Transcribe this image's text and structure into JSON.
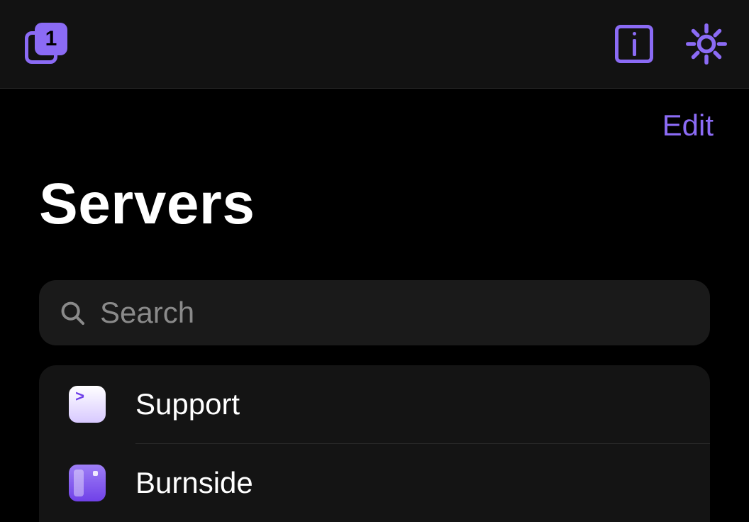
{
  "toolbar": {
    "tab_count": "1"
  },
  "header": {
    "edit_label": "Edit",
    "title": "Servers"
  },
  "search": {
    "placeholder": "Search",
    "value": ""
  },
  "servers": [
    {
      "name": "Support",
      "icon": "terminal"
    },
    {
      "name": "Burnside",
      "icon": "panel"
    }
  ],
  "colors": {
    "accent": "#8B6BF5",
    "background": "#000000",
    "surface": "#141414",
    "search_bg": "#1a1a1a",
    "text": "#ffffff",
    "muted": "#8a8a8a"
  }
}
